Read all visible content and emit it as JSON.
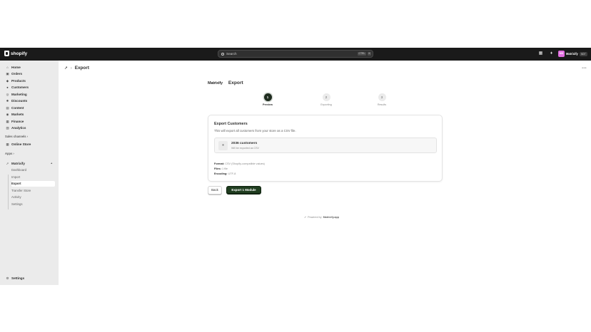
{
  "topbar": {
    "brand": "shopify",
    "search_placeholder": "Search",
    "search_kbd_1": "CTRL",
    "search_kbd_2": "K",
    "store_initials": "MS",
    "store_name": "Matrixify",
    "store_badge": "MDT"
  },
  "sidebar": {
    "items": [
      {
        "label": "Home",
        "icon": "home-icon"
      },
      {
        "label": "Orders",
        "icon": "orders-icon"
      },
      {
        "label": "Products",
        "icon": "tag-icon"
      },
      {
        "label": "Customers",
        "icon": "person-icon"
      },
      {
        "label": "Marketing",
        "icon": "target-icon"
      },
      {
        "label": "Discounts",
        "icon": "discount-icon"
      },
      {
        "label": "Content",
        "icon": "content-icon"
      },
      {
        "label": "Markets",
        "icon": "globe-icon"
      },
      {
        "label": "Finance",
        "icon": "bank-icon"
      },
      {
        "label": "Analytics",
        "icon": "chart-icon"
      }
    ],
    "sales_channels_label": "Sales channels",
    "online_store_label": "Online Store",
    "apps_label": "Apps",
    "app_name": "Matrixify",
    "app_subitems": [
      "Dashboard",
      "Import",
      "Export",
      "Transfer Store",
      "Activity",
      "Settings"
    ],
    "settings_label": "Settings"
  },
  "page": {
    "title": "Export",
    "brand_word": "Matrixify",
    "brand_title": "Export",
    "steps": [
      {
        "num": "1",
        "label": "Preview"
      },
      {
        "num": "2",
        "label": "Exporting"
      },
      {
        "num": "3",
        "label": "Results"
      }
    ],
    "card": {
      "heading": "Export Customers",
      "description": "This will export all customers from your store as a CSV file.",
      "count": "2036 customers",
      "count_sub": "Will be exported as CSV",
      "format_label": "Format:",
      "format_value": "CSV (Shopify-compatible values)",
      "files_label": "Files:",
      "files_value": "1 file",
      "encoding_label": "Encoding:",
      "encoding_value": "UTF-8"
    },
    "back_label": "Back",
    "export_label": "Export 1 Module",
    "powered_prefix": "Powered by",
    "powered_name": "Matrixify.app"
  }
}
